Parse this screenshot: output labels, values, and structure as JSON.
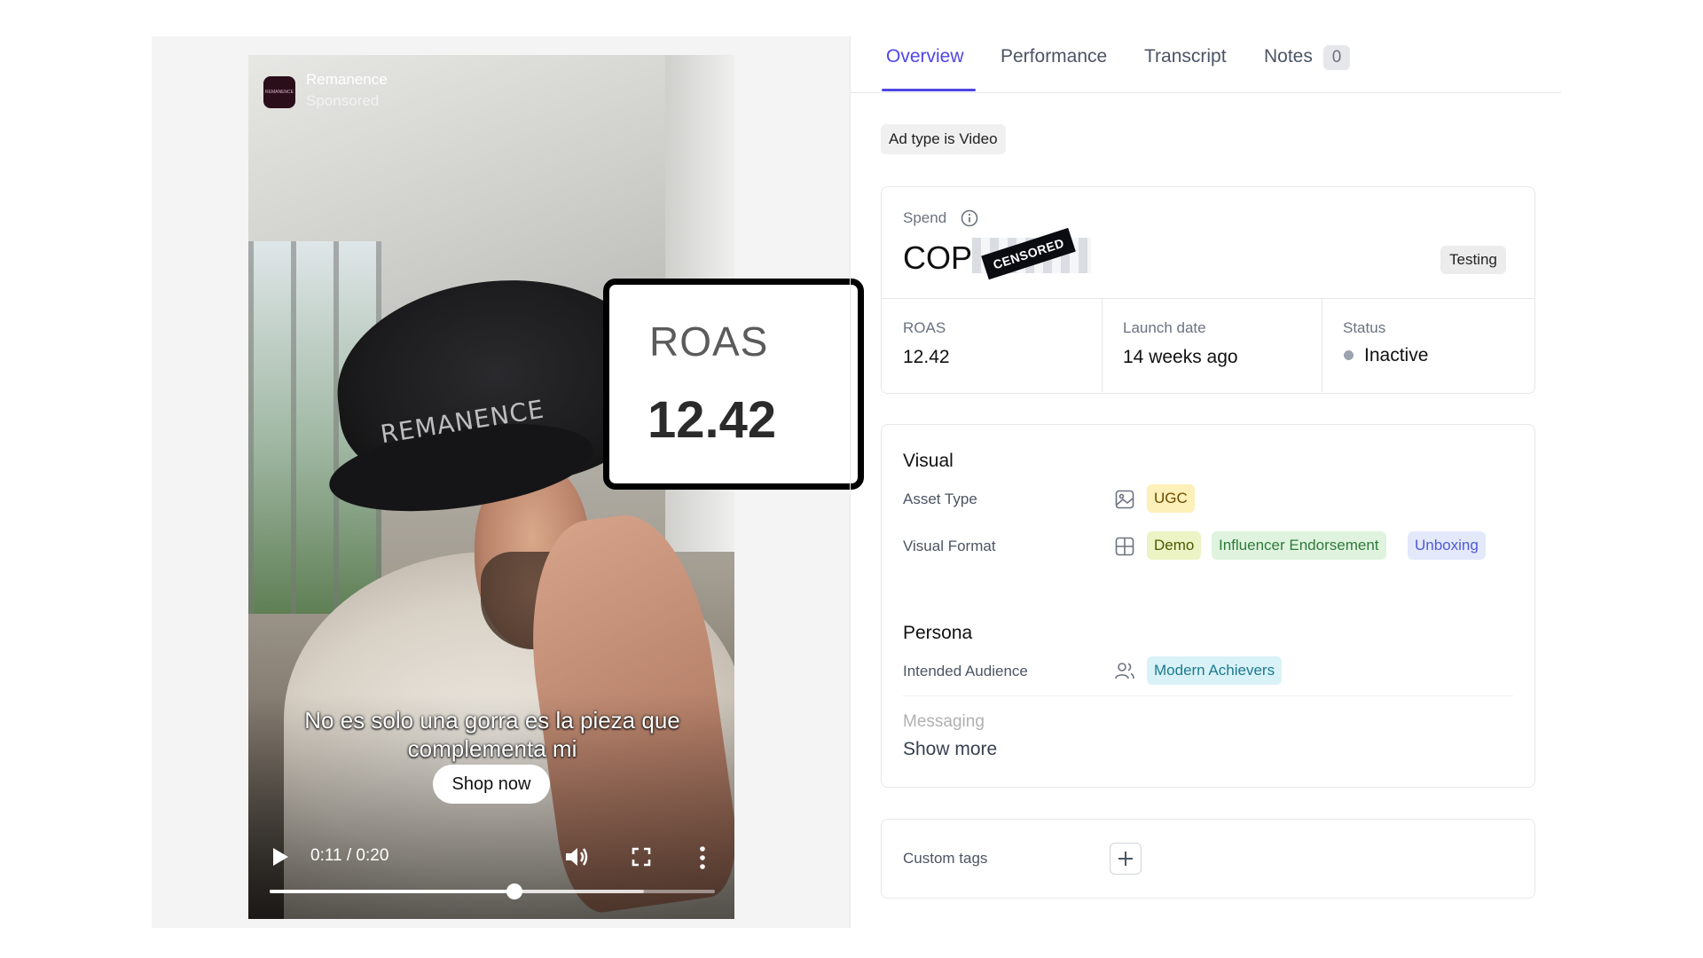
{
  "video": {
    "brand_name": "Remanence",
    "brand_subtitle": "Sponsored",
    "logo_text": "REMANENCE",
    "cap_text": "REMANENCE",
    "caption": "No es solo una gorra es la pieza que complementa mi",
    "cta_label": "Shop now",
    "time": "0:11 / 0:20",
    "progress_fraction": 0.55,
    "buffered_fraction": 0.84
  },
  "callout": {
    "label": "ROAS",
    "value": "12.42"
  },
  "tabs": [
    {
      "label": "Overview",
      "active": true
    },
    {
      "label": "Performance"
    },
    {
      "label": "Transcript"
    },
    {
      "label": "Notes",
      "count": "0"
    }
  ],
  "ad_type_pill": "Ad type is Video",
  "spend": {
    "label": "Spend",
    "value": "COP",
    "censor_label": "CENSORED",
    "badge": "Testing"
  },
  "stats": {
    "roas": {
      "label": "ROAS",
      "value": "12.42"
    },
    "launch_date": {
      "label": "Launch date",
      "value": "14 weeks ago"
    },
    "status": {
      "label": "Status",
      "value": "Inactive"
    }
  },
  "visual": {
    "title": "Visual",
    "asset_type_label": "Asset Type",
    "asset_type_tags": [
      "UGC"
    ],
    "visual_format_label": "Visual Format",
    "visual_format_tags": [
      "Demo",
      "Influencer Endorsement",
      "Unboxing"
    ]
  },
  "persona": {
    "title": "Persona",
    "audience_label": "Intended Audience",
    "audience_tags": [
      "Modern Achievers"
    ],
    "messaging_label": "Messaging",
    "show_more": "Show more"
  },
  "custom_tags": {
    "label": "Custom tags"
  },
  "colors": {
    "accent": "#4f46e5",
    "status_inactive": "#9ca3af"
  }
}
